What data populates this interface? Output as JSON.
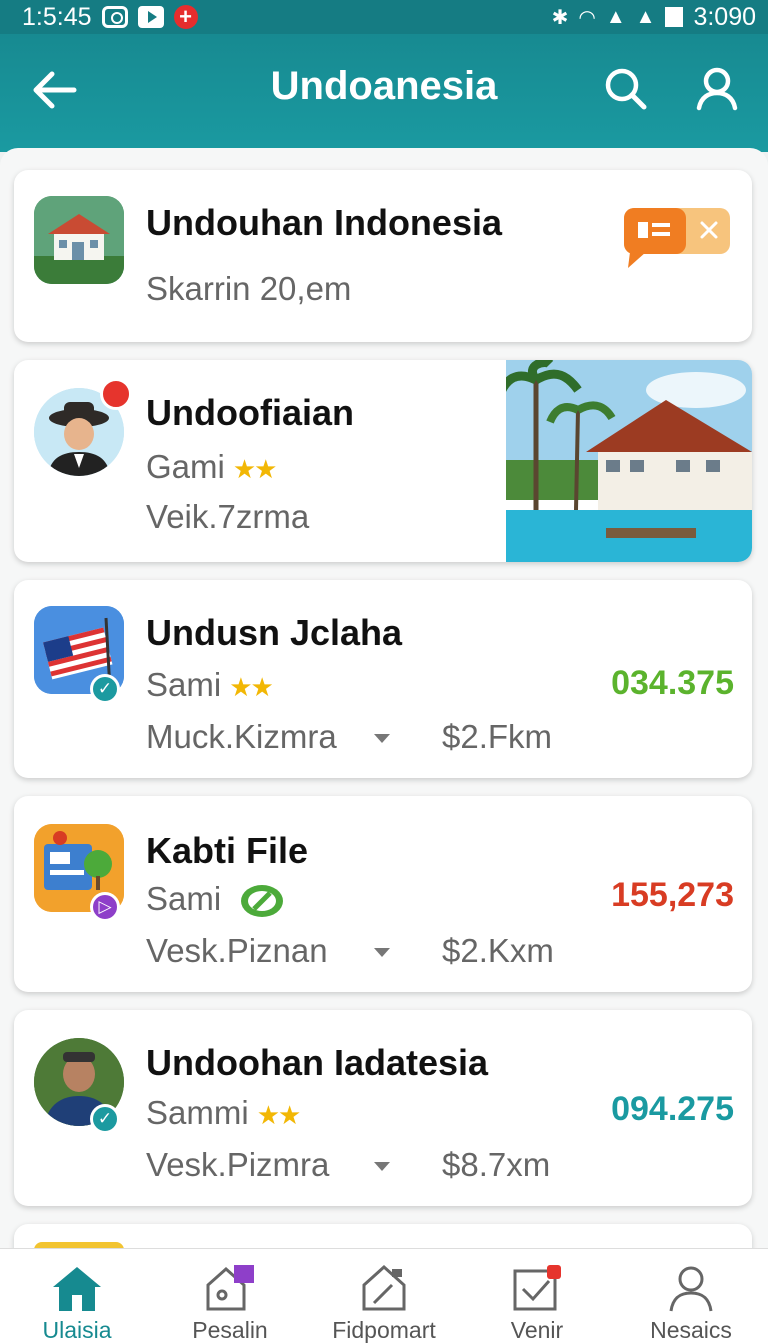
{
  "status_bar": {
    "time": "1:5:45",
    "right_time": "3:090"
  },
  "header": {
    "title": "Undoanesia"
  },
  "items": [
    {
      "title": "Undouhan Indonesia",
      "line1": "Skarrin 20,em"
    },
    {
      "title": "Undoofiaian",
      "line1": "Gami",
      "line2": "Veik.7zrma"
    },
    {
      "title": "Undusn Jclaha",
      "line1": "Sami",
      "line2": "Muck.Kizmra",
      "price": "$2.Fkm",
      "value": "034.375",
      "value_color": "#5bb32d"
    },
    {
      "title": "Kabti File",
      "line1": "Sami",
      "line2": "Vesk.Piznan",
      "price": "$2.Kxm",
      "value": "155,273",
      "value_color": "#d83c23"
    },
    {
      "title": "Undoohan Iadatesia",
      "line1": "Sammi",
      "line2": "Vesk.Pizmra",
      "price": "$8.7xm",
      "value": "094.275",
      "value_color": "#1a9aa1"
    }
  ],
  "tabs": [
    {
      "label": "Ulaisia",
      "icon": "home-icon",
      "active": true
    },
    {
      "label": "Pesalin",
      "icon": "house-flag-icon"
    },
    {
      "label": "Fidpomart",
      "icon": "document-icon"
    },
    {
      "label": "Venir",
      "icon": "checkbox-icon"
    },
    {
      "label": "Nesaics",
      "icon": "profile-icon"
    }
  ],
  "colors": {
    "accent": "#1a9aa1",
    "active_tab": "#168a90",
    "status": "#157c83"
  }
}
